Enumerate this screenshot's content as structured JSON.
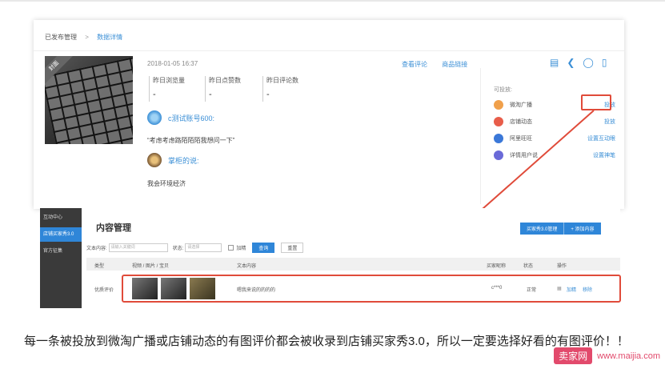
{
  "breadcrumb": {
    "parent": "已发布管理",
    "separator": ">",
    "current": "数据详情"
  },
  "post": {
    "badge": "封面",
    "date": "2018-01-05 16:37",
    "link_comments": "查看评论",
    "link_goods": "商品链接",
    "stats": [
      {
        "label": "昨日浏览量",
        "value": "-"
      },
      {
        "label": "昨日点赞数",
        "value": "-"
      },
      {
        "label": "昨日评论数",
        "value": "-"
      }
    ],
    "user_name": "c测试账号600:",
    "user_comment": "“考虑考虑路陌陌陌我想问一下”",
    "shop_name": "掌柜的说:",
    "shop_reply": "我会环境经济"
  },
  "toolbar_icons": [
    "bar-chart-icon",
    "share-icon",
    "lock-icon",
    "trash-icon"
  ],
  "channels": {
    "label": "可投放:",
    "items": [
      {
        "name": "微淘广播",
        "action": "投放",
        "color": "#f0a04b"
      },
      {
        "name": "店铺动态",
        "action": "投放",
        "color": "#e85d4a"
      },
      {
        "name": "阿里旺旺",
        "action": "设置互动眼",
        "color": "#3b78d8"
      },
      {
        "name": "详情用户说",
        "action": "设置神笔",
        "color": "#6a6ad8"
      }
    ]
  },
  "lower": {
    "sidebar": [
      "互动中心",
      "店铺买家秀3.0",
      "官方征集"
    ],
    "title": "内容管理",
    "btn_manage": "买家秀3.0管理",
    "btn_add": "+ 添加内容",
    "filter": {
      "content_label": "文本内容:",
      "content_placeholder": "请输入关键词",
      "status_label": "状态:",
      "status_placeholder": "请选择",
      "featured": "加精",
      "query": "查询",
      "reset": "重置"
    },
    "columns": [
      "类型",
      "视频 / 图片 / 宝贝",
      "文本内容",
      "买家昵称",
      "状态",
      "操作"
    ],
    "row": {
      "type": "优质评价",
      "text": "嗯我来说的的的的",
      "buyer": "c***0",
      "status": "正常",
      "ops": [
        "加精",
        "移除"
      ]
    }
  },
  "caption": "每一条被投放到微淘广播或店铺动态的有图评价都会被收录到店铺买家秀3.0，所以一定要选择好看的有图评价！！",
  "watermark": {
    "logo": "卖家网",
    "url": "www.maijia.com"
  }
}
